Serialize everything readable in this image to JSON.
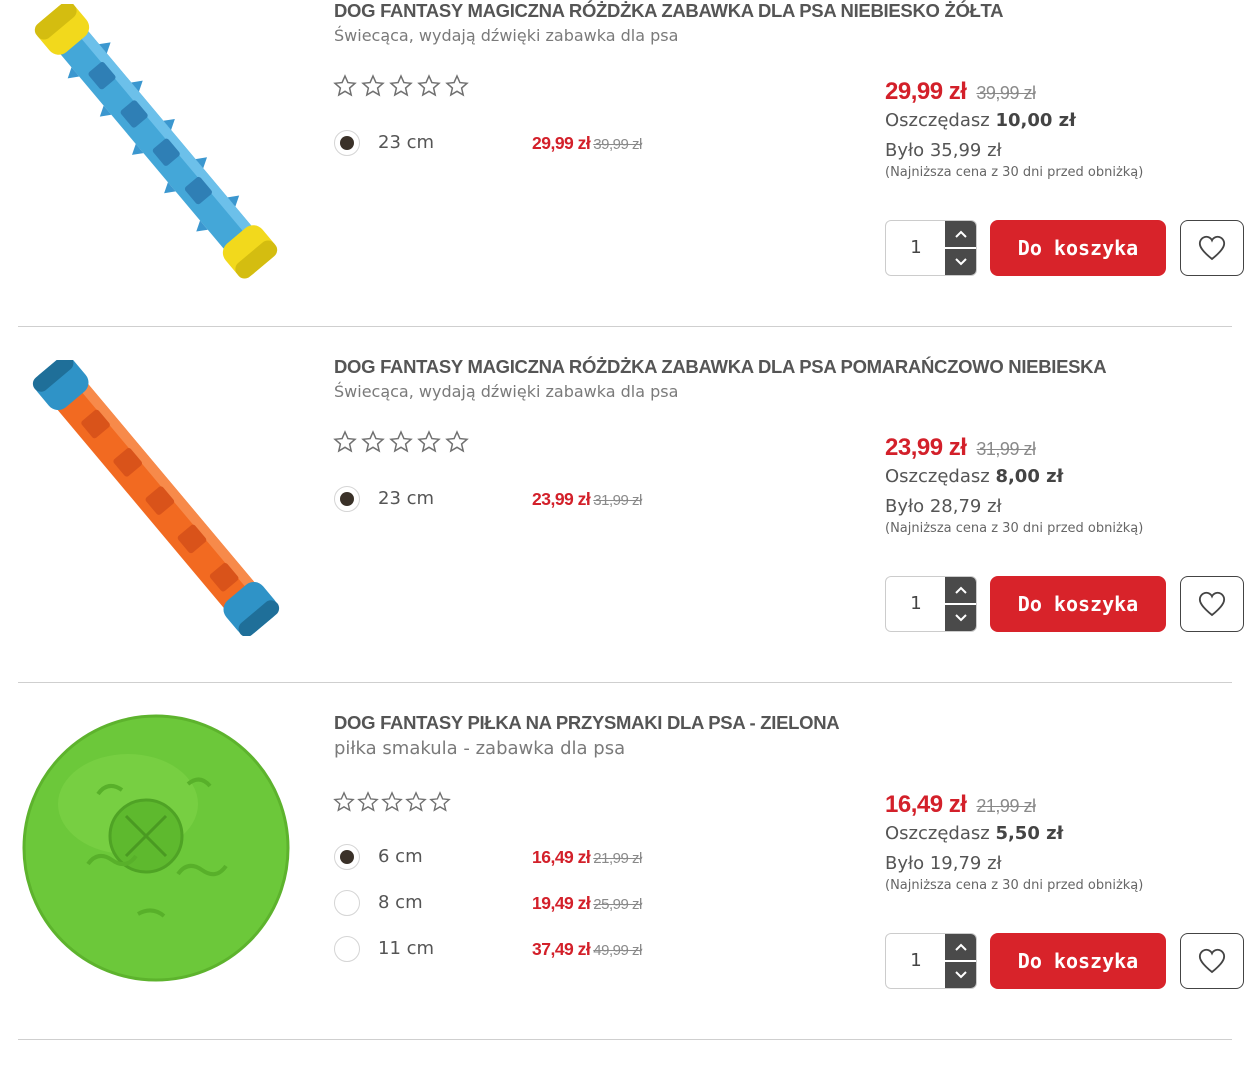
{
  "products": [
    {
      "title": "DOG FANTASY MAGICZNA RÓŻDŻKA ZABAWKA DLA PSA NIEBIESKO ŻÓŁTA",
      "subtitle": "Świecąca, wydają dźwięki zabawka dla psa",
      "image": "blue-yellow-wand-toy",
      "rating_stars": 0,
      "variants": [
        {
          "size": "23 cm",
          "price": "29,99 zł",
          "old_price": "39,99 zł",
          "selected": true
        }
      ],
      "price": "29,99 zł",
      "old_price": "39,99 zł",
      "save_label": "Oszczędasz",
      "save_value": "10,00 zł",
      "was": "Było 35,99 zł",
      "lowest_note": "(Najniższa cena z 30 dni przed obniżką)",
      "quantity": "1",
      "cart_label": "Do koszyka"
    },
    {
      "title": "DOG FANTASY MAGICZNA RÓŻDŻKA ZABAWKA DLA PSA POMARAŃCZOWO NIEBIESKA",
      "subtitle": "Świecąca, wydają dźwięki zabawka dla psa",
      "image": "orange-blue-wand-toy",
      "rating_stars": 0,
      "variants": [
        {
          "size": "23 cm",
          "price": "23,99 zł",
          "old_price": "31,99 zł",
          "selected": true
        }
      ],
      "price": "23,99 zł",
      "old_price": "31,99 zł",
      "save_label": "Oszczędasz",
      "save_value": "8,00 zł",
      "was": "Było 28,79 zł",
      "lowest_note": "(Najniższa cena z 30 dni przed obniżką)",
      "quantity": "1",
      "cart_label": "Do koszyka"
    },
    {
      "title": "DOG FANTASY PIŁKA NA PRZYSMAKI DLA PSA - ZIELONA",
      "subtitle": "piłka smakula - zabawka dla psa",
      "image": "green-treat-ball",
      "rating_stars": 0,
      "variants": [
        {
          "size": "6 cm",
          "price": "16,49 zł",
          "old_price": "21,99 zł",
          "selected": true
        },
        {
          "size": "8 cm",
          "price": "19,49 zł",
          "old_price": "25,99 zł",
          "selected": false
        },
        {
          "size": "11 cm",
          "price": "37,49 zł",
          "old_price": "49,99 zł",
          "selected": false
        }
      ],
      "price": "16,49 zł",
      "old_price": "21,99 zł",
      "save_label": "Oszczędasz",
      "save_value": "5,50 zł",
      "was": "Było 19,79 zł",
      "lowest_note": "(Najniższa cena z 30 dni przed obniżką)",
      "quantity": "1",
      "cart_label": "Do koszyka"
    }
  ],
  "colors": {
    "price_red": "#d3202a",
    "cart_button": "#d8232a",
    "radio_selected": "#3a3128"
  },
  "icons": {
    "star": "star-outline-icon",
    "qty_up": "chevron-up-icon",
    "qty_down": "chevron-down-icon",
    "favorite": "heart-outline-icon"
  }
}
